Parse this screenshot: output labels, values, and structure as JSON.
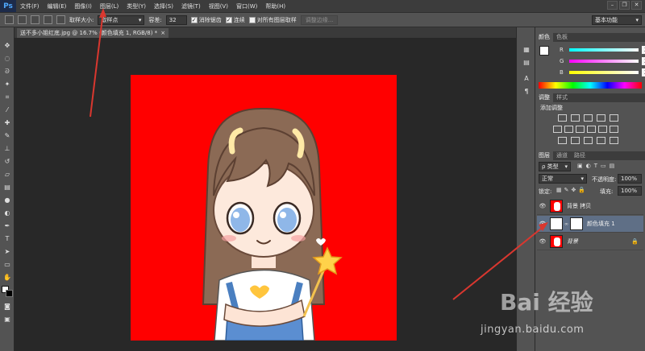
{
  "app": {
    "logo": "Ps"
  },
  "menu": [
    "文件(F)",
    "编辑(E)",
    "图像(I)",
    "图层(L)",
    "类型(Y)",
    "选择(S)",
    "滤镜(T)",
    "视图(V)",
    "窗口(W)",
    "帮助(H)"
  ],
  "window_controls": {
    "minimize": "–",
    "restore": "❐",
    "close": "✕"
  },
  "options": {
    "sample_size_label": "取样大小:",
    "sample_size_value": "取样点",
    "tolerance_label": "容差:",
    "tolerance_value": "32",
    "antialias_label": "消除锯齿",
    "contiguous_label": "连续",
    "sample_all_label": "对所有图层取样",
    "refine_edge_label": "调整边缘...",
    "workspace_value": "基本功能"
  },
  "document": {
    "tab_title": "送不多小姐红底.jpg @ 16.7% (颜色填充 1, RGB/8) *",
    "tab_close": "×"
  },
  "color_panel": {
    "tabs": [
      "颜色",
      "色板"
    ],
    "channels": [
      {
        "letter": "R",
        "value": "255"
      },
      {
        "letter": "G",
        "value": "255"
      },
      {
        "letter": "B",
        "value": "255"
      }
    ]
  },
  "adjust_panel": {
    "tabs": [
      "调整",
      "样式"
    ],
    "title": "添加调整"
  },
  "layers_panel": {
    "tabs": [
      "图层",
      "通道",
      "路径"
    ],
    "filter_value": "ρ 类型",
    "blend_mode": "正常",
    "opacity_label": "不透明度:",
    "opacity_value": "100%",
    "lock_label": "锁定:",
    "fill_label": "填充:",
    "fill_value": "100%",
    "layers": [
      {
        "name": "背景 拷贝",
        "visible": true,
        "selected": false
      },
      {
        "name": "颜色填充 1",
        "visible": true,
        "selected": true
      },
      {
        "name": "背景",
        "visible": true,
        "selected": false
      }
    ]
  },
  "watermark": {
    "brand": "Bai 经验",
    "url": "jingyan.baidu.com"
  },
  "colors": {
    "canvas_fill": "#ff0000",
    "ui_dark": "#282828",
    "ui_panel": "#535353",
    "selection": "#5f6f86",
    "arrow": "#d9372f"
  }
}
